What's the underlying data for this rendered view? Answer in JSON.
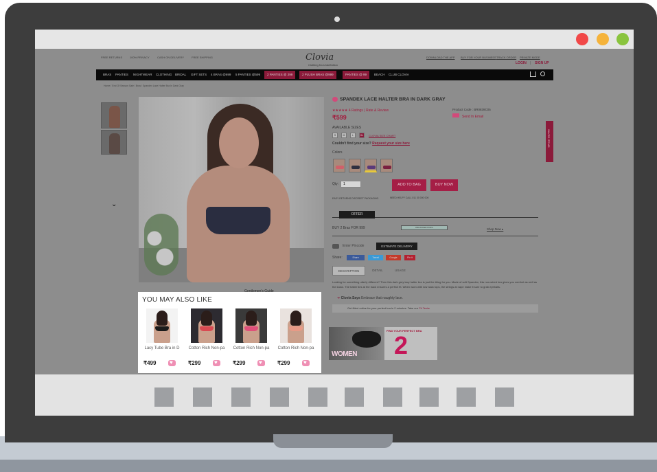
{
  "colors": {
    "accent": "#a51e46",
    "window_red": "#f14848",
    "window_yellow": "#f5b33b",
    "window_green": "#8ac43e"
  },
  "site": {
    "logo": "Clovia",
    "tagline": "Clothing Ka Undefinition",
    "top_links": [
      "FREE RETURNS",
      "100% PRIVACY",
      "CASH ON DELIVERY",
      "FREE SHIPPING"
    ],
    "top_right_links": [
      "DOWNLOAD THE APP",
      "BUY FOR YOUR BUSINESS",
      "TRACK ORDER",
      "PRIVATE MODE"
    ],
    "login": "LOGIN",
    "signup": "SIGN UP",
    "nav": [
      "BRAS",
      "PANTIES",
      "NIGHTWEAR",
      "CLOTHING",
      "BRIDAL",
      "GIFT SETS",
      "4 BRAS @699",
      "5 PANTIES @599"
    ],
    "nav_pills": [
      "2 PANTIES @ 299",
      "2 PLUSH BRAS @999",
      "PANTIES @ 99"
    ],
    "nav_tail": [
      "BEACH",
      "CLUB CLOVIA"
    ],
    "breadcrumb": "Home / End Of Season Sale / Bras / Spandex Lace Halter Bra In Dark Gray"
  },
  "product": {
    "title": "SPANDEX LACE HALTER BRA IN DARK GRAY",
    "rating_text": "4 Ratings | Rate & Review",
    "price": "₹599",
    "product_code": "Product Code : BR0839C05",
    "send_email": "Send In Email",
    "sizes_label": "AVAILABLE SIZES",
    "sizes": [
      "S",
      "M",
      "L",
      "XL"
    ],
    "size_chart": "CLOVIA SIZE CHART",
    "size_help": "Couldn't find your size?",
    "size_request": "Request your size here",
    "colors_label": "Colors",
    "qty_label": "Qty:",
    "qty_value": "1",
    "add_to_bag": "ADD TO BAG",
    "buy_now": "BUY NOW",
    "perks": "EASY RETURNS     DISCREET PACKAGING",
    "help": "NEED HELP? CALL 011 30 000 000",
    "offer_tab": "OFFER",
    "offer_text": "BUY 2 Bras FOR 999",
    "offer_unlock": "UNLOCKED FOR 2",
    "shop_now": "Shop Now ▸",
    "pincode": "Enter Pincode",
    "estimate": "ESTIMATE DELIVERY",
    "share_label": "Share:",
    "share_buttons": [
      "Share",
      "Tweet",
      "Google",
      "Pin it"
    ],
    "tabs": [
      "DESCRIPTION",
      "DETAIL",
      "USAGE"
    ],
    "description": "Looking for something utterly different? Then this dark grey lacy halter bra is just the thing for you. Made of soft Spandex, this non-wired bra gives you comfort as well as the looks. The halter ties at the back ensures a perfect fit. When worn with low back tops, the strings at nape make it sure to grab eyeballs.",
    "clovia_says_label": "Clovia Says",
    "clovia_says": "Embrace that naughty lace.",
    "fit_text": "Get fitted online for your perfect bra in 2 minutes. Take our",
    "fit_link": "Fit Test ▸",
    "gentlemen_guide": "Gentlemen's Guide",
    "saved_items": "SAVED ITEMS"
  },
  "banners": {
    "women": "WOMEN",
    "bra_title": "FIND YOUR PERFECT BRA",
    "bra_big": "2"
  },
  "ymal": {
    "title": "YOU MAY ALSO LIKE",
    "items": [
      {
        "name": "Lacy Tube Bra in D",
        "price": "₹499",
        "bra_color": "#1b1b1b",
        "bg": "#f3f3f3"
      },
      {
        "name": "Cotton Rich Non-pa",
        "price": "₹299",
        "bra_color": "#d94a52",
        "bg": "#2d2b31"
      },
      {
        "name": "Cotton Rich Non-pa",
        "price": "₹299",
        "bra_color": "#e0507a",
        "bg": "#3a3a3a"
      },
      {
        "name": "Cotton Rich Non-pa",
        "price": "₹299",
        "bra_color": "#e89a86",
        "bg": "#e9e2de"
      }
    ]
  }
}
